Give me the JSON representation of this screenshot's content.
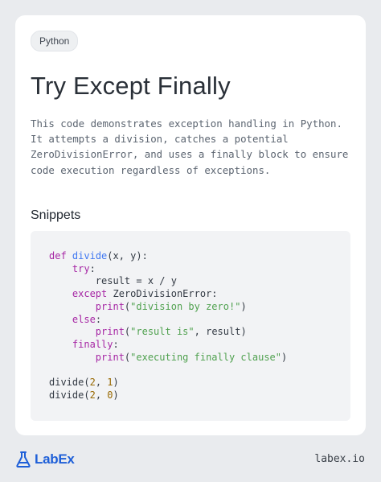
{
  "tag": "Python",
  "title": "Try Except Finally",
  "description": "This code demonstrates exception handling in Python. It attempts a division, catches a potential ZeroDivisionError, and uses a finally block to ensure code execution regardless of exceptions.",
  "snippets_heading": "Snippets",
  "code": {
    "def_kw": "def",
    "func_name": "divide",
    "params": "(x, y):",
    "try_kw": "try",
    "result_line": "result = x / y",
    "except_kw": "except",
    "exception_name": " ZeroDivisionError:",
    "print_fn": "print",
    "str_zero": "\"division by zero!\"",
    "else_kw": "else",
    "str_result": "\"result is\"",
    "result_arg": ", result)",
    "finally_kw": "finally",
    "str_finally": "\"executing finally clause\"",
    "call_name": "divide",
    "call1_arg1": "2",
    "call1_arg2": "1",
    "call2_arg1": "2",
    "call2_arg2": "0"
  },
  "footer": {
    "logo_text": "LabEx",
    "url": "labex.io"
  },
  "colors": {
    "keyword": "#a626a4",
    "function": "#4078f2",
    "string": "#50a14f",
    "number": "#986801",
    "brand": "#1e5fd8"
  }
}
